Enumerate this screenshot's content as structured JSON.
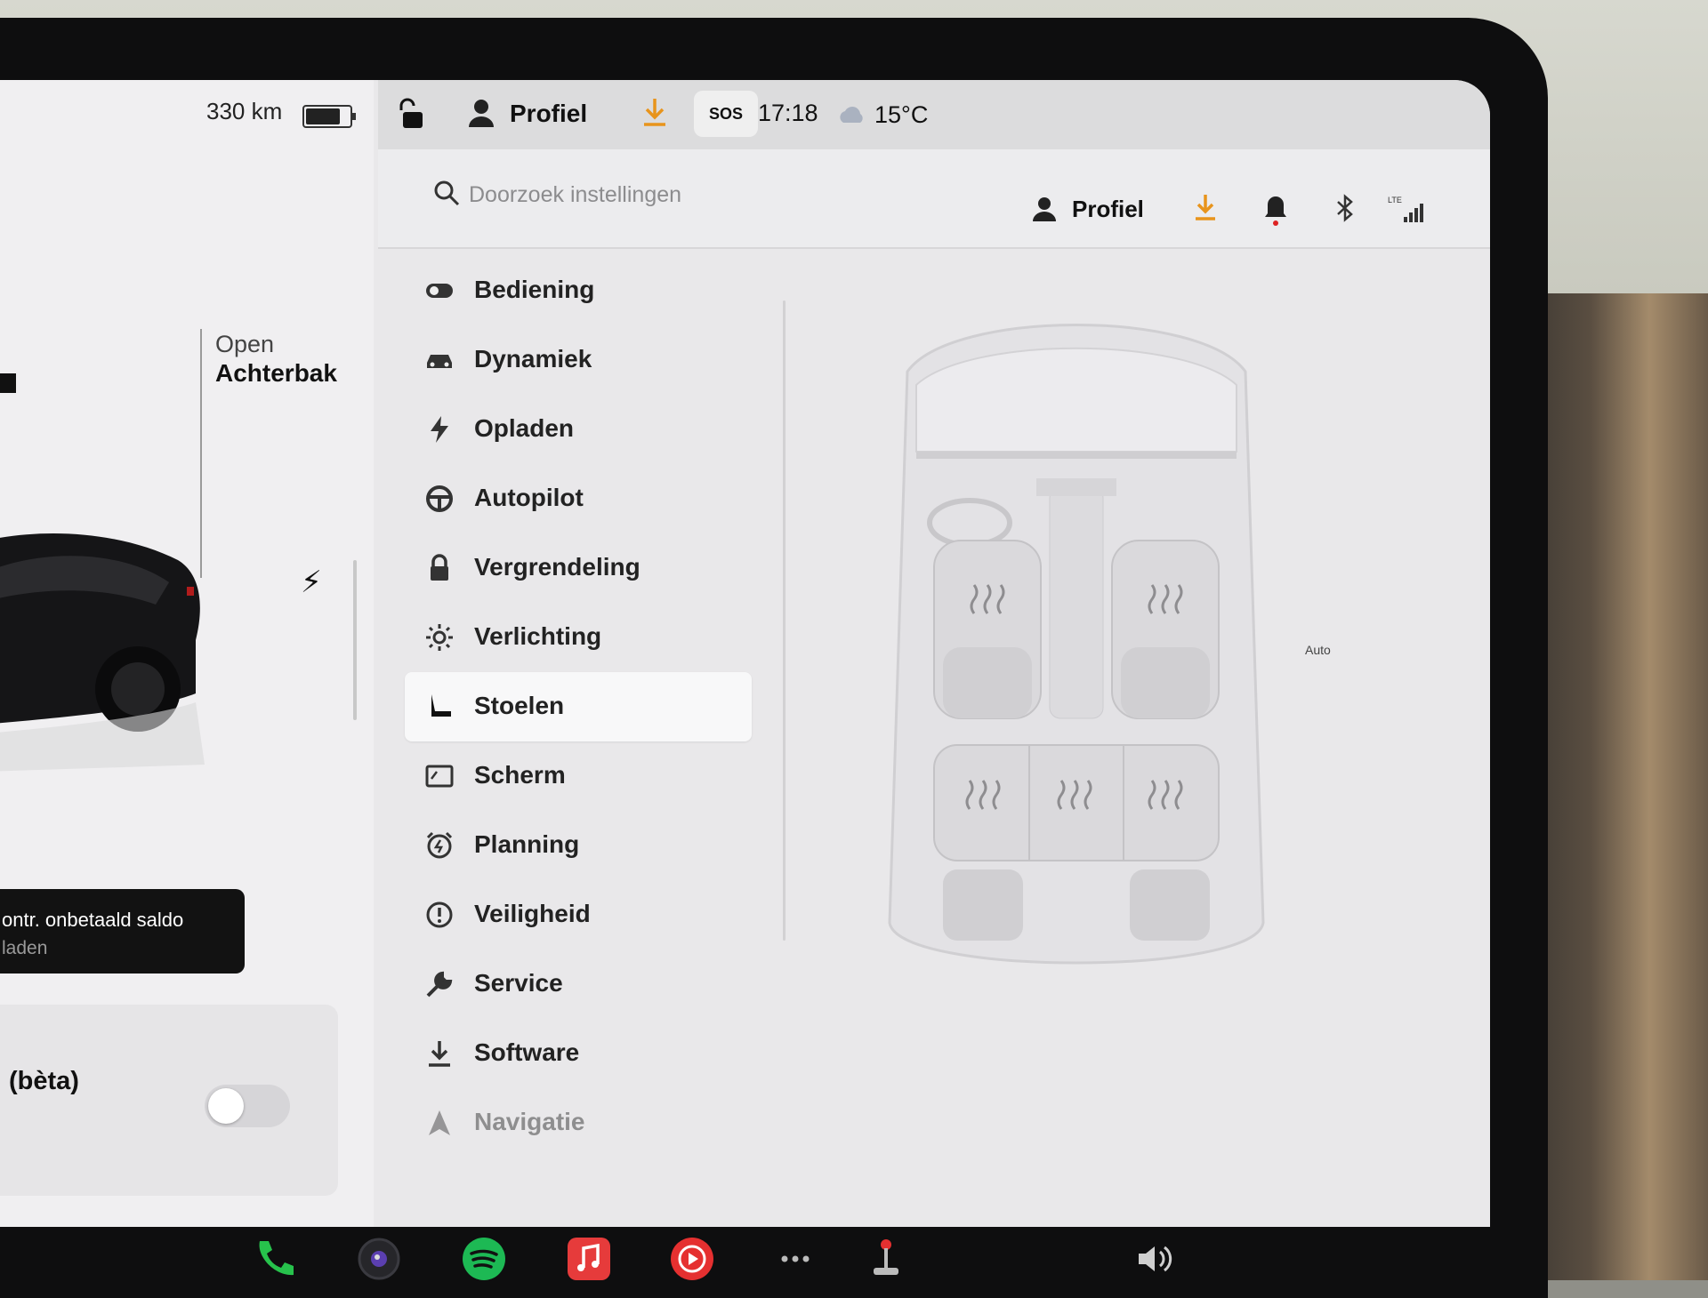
{
  "vehicle": {
    "range": "330 km",
    "trunk": {
      "action": "Open",
      "name": "Achterbak"
    }
  },
  "toast": {
    "line1": "ontr. onbetaald saldo",
    "line2": "laden"
  },
  "beta_card": {
    "label": "(bèta)",
    "toggle_on": false
  },
  "status_bar": {
    "profile": "Profiel",
    "sos": "SOS",
    "time": "17:18",
    "temperature": "15°C"
  },
  "settings": {
    "search": {
      "placeholder": "Doorzoek instellingen"
    },
    "header": {
      "profile": "Profiel",
      "signal": "LTE"
    },
    "menu": [
      {
        "label": "Bediening",
        "icon": "toggle-icon"
      },
      {
        "label": "Dynamiek",
        "icon": "car-icon"
      },
      {
        "label": "Opladen",
        "icon": "bolt-icon"
      },
      {
        "label": "Autopilot",
        "icon": "steering-wheel-icon"
      },
      {
        "label": "Vergrendeling",
        "icon": "lock-icon"
      },
      {
        "label": "Verlichting",
        "icon": "sun-icon"
      },
      {
        "label": "Stoelen",
        "icon": "seat-icon",
        "active": true
      },
      {
        "label": "Scherm",
        "icon": "screen-icon"
      },
      {
        "label": "Planning",
        "icon": "alarm-icon"
      },
      {
        "label": "Veiligheid",
        "icon": "alert-circle-icon"
      },
      {
        "label": "Service",
        "icon": "wrench-icon"
      },
      {
        "label": "Software",
        "icon": "download-icon"
      },
      {
        "label": "Navigatie",
        "icon": "navigation-icon"
      }
    ],
    "seats": {
      "front_right_mode": "Auto"
    }
  },
  "colors": {
    "accent_orange": "#e8941c",
    "spotify_green": "#1db954",
    "phone_green": "#27c24c",
    "music_red": "#e63b3b",
    "youtube_red": "#e53030"
  }
}
